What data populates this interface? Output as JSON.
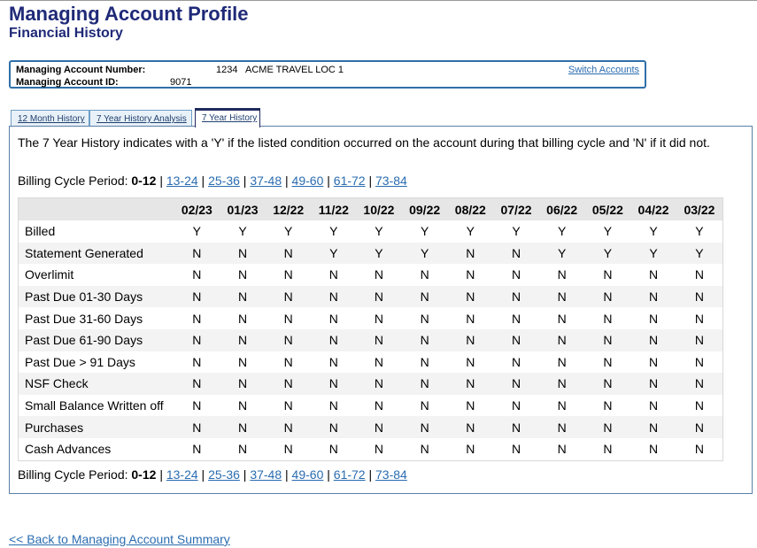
{
  "header": {
    "title": "Managing Account Profile",
    "subtitle": "Financial History"
  },
  "account": {
    "number_label": "Managing Account Number:",
    "number_value": "1234",
    "account_name": "ACME TRAVEL LOC 1",
    "id_label": "Managing Account ID:",
    "id_value": "9071",
    "switch_label": "Switch Accounts"
  },
  "tabs": [
    {
      "label": "12 Month History",
      "active": false
    },
    {
      "label": "7 Year History Analysis",
      "active": false
    },
    {
      "label": "7 Year History",
      "active": true
    }
  ],
  "description": "The 7 Year History indicates with a 'Y' if the listed condition occurred on the account during that billing cycle and 'N' if it did not.",
  "billing_cycle": {
    "label": "Billing Cycle Period:",
    "current": "0-12",
    "separator": "|",
    "periods": [
      "13-24",
      "25-36",
      "37-48",
      "49-60",
      "61-72",
      "73-84"
    ]
  },
  "table": {
    "columns": [
      "02/23",
      "01/23",
      "12/22",
      "11/22",
      "10/22",
      "09/22",
      "08/22",
      "07/22",
      "06/22",
      "05/22",
      "04/22",
      "03/22"
    ],
    "rows": [
      {
        "label": "Billed",
        "values": [
          "Y",
          "Y",
          "Y",
          "Y",
          "Y",
          "Y",
          "Y",
          "Y",
          "Y",
          "Y",
          "Y",
          "Y"
        ]
      },
      {
        "label": "Statement Generated",
        "values": [
          "N",
          "N",
          "N",
          "Y",
          "Y",
          "Y",
          "N",
          "N",
          "Y",
          "Y",
          "Y",
          "Y"
        ]
      },
      {
        "label": "Overlimit",
        "values": [
          "N",
          "N",
          "N",
          "N",
          "N",
          "N",
          "N",
          "N",
          "N",
          "N",
          "N",
          "N"
        ]
      },
      {
        "label": "Past Due 01-30 Days",
        "values": [
          "N",
          "N",
          "N",
          "N",
          "N",
          "N",
          "N",
          "N",
          "N",
          "N",
          "N",
          "N"
        ]
      },
      {
        "label": "Past Due 31-60 Days",
        "values": [
          "N",
          "N",
          "N",
          "N",
          "N",
          "N",
          "N",
          "N",
          "N",
          "N",
          "N",
          "N"
        ]
      },
      {
        "label": "Past Due 61-90 Days",
        "values": [
          "N",
          "N",
          "N",
          "N",
          "N",
          "N",
          "N",
          "N",
          "N",
          "N",
          "N",
          "N"
        ]
      },
      {
        "label": "Past Due > 91 Days",
        "values": [
          "N",
          "N",
          "N",
          "N",
          "N",
          "N",
          "N",
          "N",
          "N",
          "N",
          "N",
          "N"
        ]
      },
      {
        "label": "NSF Check",
        "values": [
          "N",
          "N",
          "N",
          "N",
          "N",
          "N",
          "N",
          "N",
          "N",
          "N",
          "N",
          "N"
        ]
      },
      {
        "label": "Small Balance Written off",
        "values": [
          "N",
          "N",
          "N",
          "N",
          "N",
          "N",
          "N",
          "N",
          "N",
          "N",
          "N",
          "N"
        ]
      },
      {
        "label": "Purchases",
        "values": [
          "N",
          "N",
          "N",
          "N",
          "N",
          "N",
          "N",
          "N",
          "N",
          "N",
          "N",
          "N"
        ]
      },
      {
        "label": "Cash Advances",
        "values": [
          "N",
          "N",
          "N",
          "N",
          "N",
          "N",
          "N",
          "N",
          "N",
          "N",
          "N",
          "N"
        ]
      }
    ]
  },
  "footer": {
    "back_link": "<< Back to Managing Account Summary"
  },
  "colors": {
    "title": "#1f2a78",
    "link": "#2a6cb0",
    "box_border": "#2f6fa8"
  }
}
